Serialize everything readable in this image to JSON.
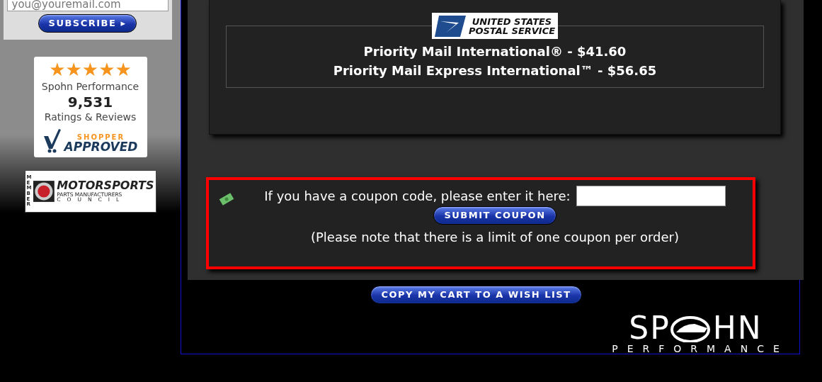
{
  "newsletter": {
    "email_value": "you@youremail.com",
    "subscribe_button": "SUBSCRIBE ▸"
  },
  "ratings_badge": {
    "stars": 5,
    "company": "Spohn Performance",
    "count": "9,531",
    "caption": "Ratings & Reviews",
    "brand_top": "SHOPPER",
    "brand_bottom": "APPROVED"
  },
  "member_badge": {
    "side": "MEMBER",
    "title": "MOTORSPORTS",
    "subtitle": "PARTS MANUFACTURERS",
    "council": "COUNCIL"
  },
  "shipping": {
    "carrier_logo": [
      "UNITED STATES",
      "POSTAL SERVICE"
    ],
    "options": [
      "Priority Mail International® - $41.60",
      "Priority Mail Express International™ - $56.65"
    ]
  },
  "coupon": {
    "prompt": "If you have a coupon code, please enter it here:",
    "submit_button": "SUBMIT COUPON",
    "note": "(Please note that there is a limit of one coupon per order)",
    "highlighted": true
  },
  "wish_list_button": "COPY MY CART TO A WISH LIST",
  "footer_logo": {
    "left": "SP",
    "right": "HN",
    "tagline": "PERFORMANCE"
  }
}
